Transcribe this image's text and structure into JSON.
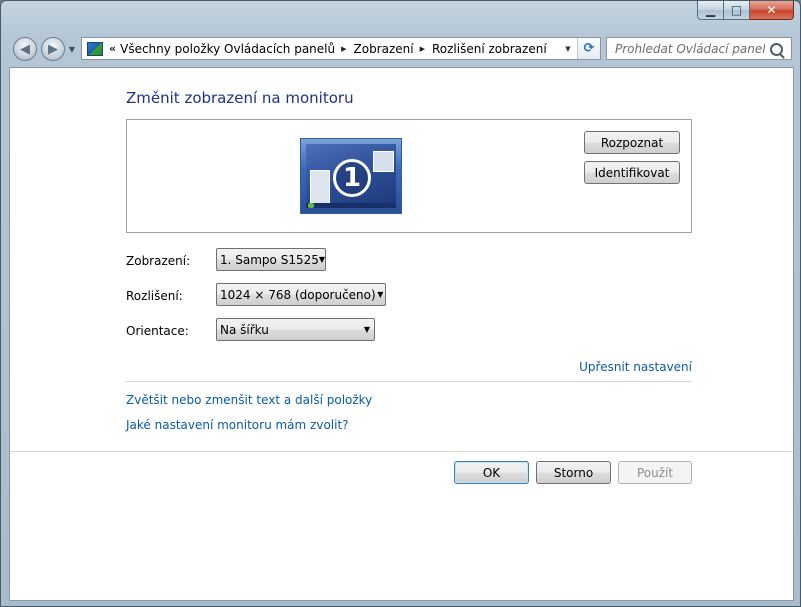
{
  "window": {
    "minimize_glyph": "▁",
    "maximize_glyph": "□",
    "close_glyph": "✕"
  },
  "nav": {
    "back_glyph": "◀",
    "forward_glyph": "▶",
    "dropdown_glyph": "▼"
  },
  "address": {
    "prefix_glyph": "«",
    "breadcrumbs": [
      "Všechny položky Ovládacích panelů",
      "Zobrazení",
      "Rozlišení zobrazení"
    ],
    "dropdown_glyph": "▼",
    "refresh_glyph": "⟳"
  },
  "search": {
    "placeholder": "Prohledat Ovládací panely"
  },
  "main": {
    "title": "Změnit zobrazení na monitoru",
    "monitor_number": "1",
    "detect_label": "Rozpoznat",
    "identify_label": "Identifikovat",
    "fields": {
      "display": {
        "label": "Zobrazení:",
        "value": "1. Sampo S1525"
      },
      "resolution": {
        "label": "Rozlišení:",
        "value": "1024 × 768 (doporučeno)"
      },
      "orientation": {
        "label": "Orientace:",
        "value": "Na šířku"
      }
    },
    "combo_arrow": "▼",
    "advanced_link": "Upřesnit nastavení",
    "text_size_link": "Zvětšit nebo zmenšit text a další položky",
    "which_settings_link": "Jaké nastavení monitoru mám zvolit?"
  },
  "footer": {
    "ok_label": "OK",
    "cancel_label": "Storno",
    "apply_label": "Použít"
  },
  "colors": {
    "title": "#1e3287",
    "link": "#0e5aa5",
    "disabled_text": "#8d8d8d"
  }
}
